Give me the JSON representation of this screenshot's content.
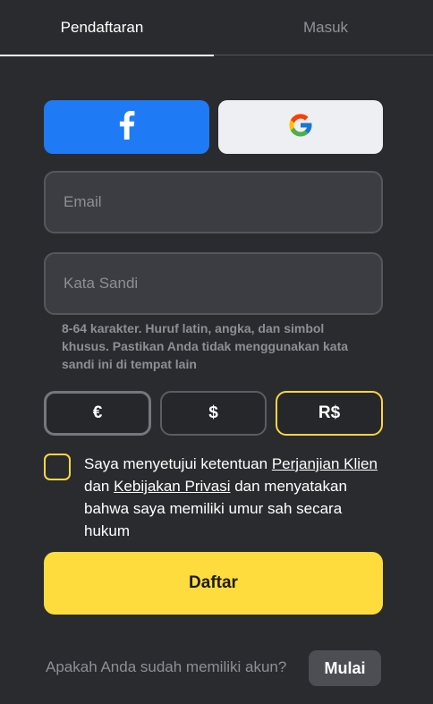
{
  "tabs": {
    "register": "Pendaftaran",
    "login": "Masuk"
  },
  "social": {
    "facebook_icon": "facebook-icon",
    "google_icon": "google-icon"
  },
  "form": {
    "email_placeholder": "Email",
    "password_placeholder": "Kata Sandi",
    "password_hint": "8-64 karakter. Huruf latin, angka, dan simbol khusus. Pastikan Anda tidak menggunakan kata sandi ini di tempat lain"
  },
  "currencies": [
    {
      "symbol": "€"
    },
    {
      "symbol": "$"
    },
    {
      "symbol": "R$",
      "selected": true
    }
  ],
  "terms": {
    "prefix": "Saya menyetujui ketentuan ",
    "link1": "Perjanjian Klien",
    "middle": " dan ",
    "link2": "Kebijakan Privasi",
    "suffix": " dan menyatakan bahwa saya memiliki umur sah secara hukum"
  },
  "submit_label": "Daftar",
  "footer": {
    "question": "Apakah Anda sudah memiliki akun?",
    "start_label": "Mulai"
  },
  "colors": {
    "background": "#2a2b2e",
    "accent": "#fedc3d",
    "facebook": "#1f7af5"
  }
}
